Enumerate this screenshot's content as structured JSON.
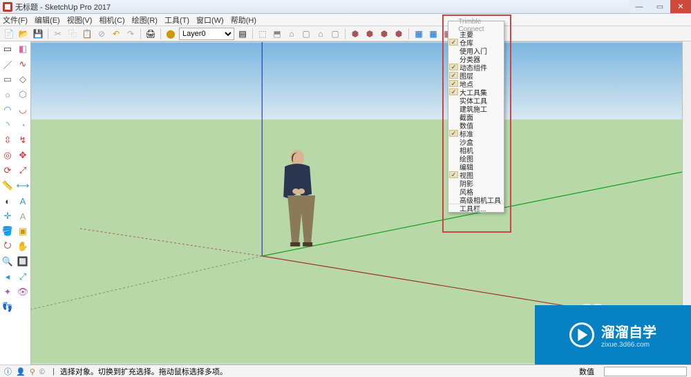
{
  "title": "无标题 - SketchUp Pro 2017",
  "menu": [
    "文件(F)",
    "编辑(E)",
    "视图(V)",
    "相机(C)",
    "绘图(R)",
    "工具(T)",
    "窗口(W)",
    "帮助(H)"
  ],
  "layer_label": "Layer0",
  "status": {
    "hint": "选择对象。切换到扩充选择。拖动鼠标选择多项。",
    "measure_label": "数值"
  },
  "context_menu": [
    {
      "label": "Trimble Connect",
      "checked": false
    },
    {
      "label": "主要",
      "checked": false
    },
    {
      "label": "仓库",
      "checked": true
    },
    {
      "label": "使用入门",
      "checked": false
    },
    {
      "label": "分类器",
      "checked": false
    },
    {
      "label": "动态组件",
      "checked": true
    },
    {
      "label": "图层",
      "checked": true
    },
    {
      "label": "地点",
      "checked": true
    },
    {
      "label": "大工具集",
      "checked": true
    },
    {
      "label": "实体工具",
      "checked": false
    },
    {
      "label": "建筑施工",
      "checked": false
    },
    {
      "label": "截面",
      "checked": false
    },
    {
      "label": "数值",
      "checked": false
    },
    {
      "label": "标准",
      "checked": true
    },
    {
      "label": "沙盒",
      "checked": false
    },
    {
      "label": "相机",
      "checked": false
    },
    {
      "label": "绘图",
      "checked": false
    },
    {
      "label": "编辑",
      "checked": false
    },
    {
      "label": "视图",
      "checked": true
    },
    {
      "label": "阴影",
      "checked": false
    },
    {
      "label": "风格",
      "checked": false
    },
    {
      "label": "高级相机工具",
      "checked": false
    },
    {
      "label": "工具栏...",
      "checked": false
    }
  ],
  "watermark": {
    "main": "溜溜自学",
    "sub": "zixue.3d66.com"
  }
}
